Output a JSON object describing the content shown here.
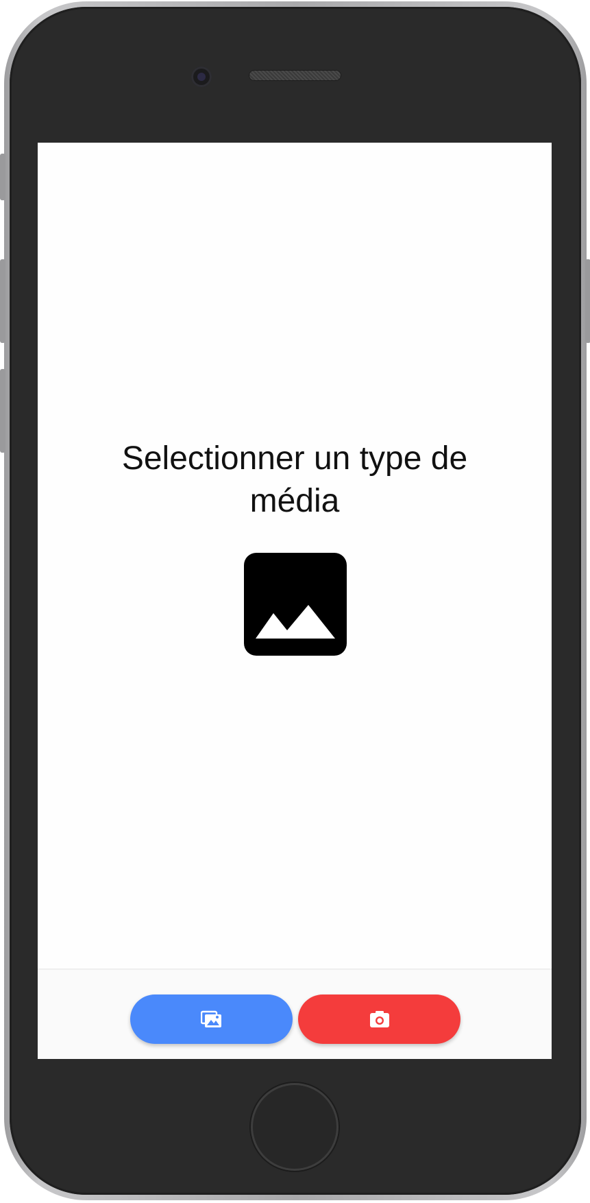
{
  "screen": {
    "title": "Selectionner un type de média",
    "placeholder_icon": "image-icon"
  },
  "bottom_bar": {
    "gallery_button": {
      "icon": "gallery-icon",
      "color": "#4a89fb"
    },
    "camera_button": {
      "icon": "camera-icon",
      "color": "#f43c3c"
    }
  },
  "device": {
    "frame_color": "#2a2a2a"
  }
}
